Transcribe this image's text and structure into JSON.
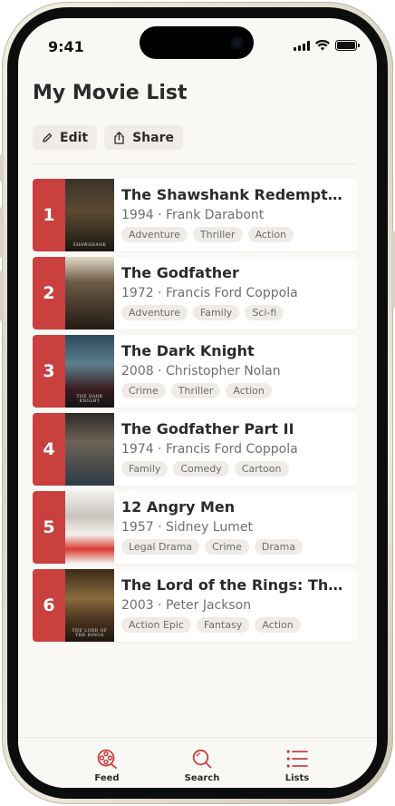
{
  "status_bar": {
    "time": "9:41"
  },
  "header": {
    "title": "My Movie List"
  },
  "actions": {
    "edit_label": "Edit",
    "share_label": "Share"
  },
  "movies": [
    {
      "rank": "1",
      "title": "The Shawshank Redemption",
      "meta": "1994 · Frank Darabont",
      "tags": [
        "Adventure",
        "Thriller",
        "Action"
      ],
      "poster_bg": "linear-gradient(180deg,#3b3329 0%,#5b4a33 45%,#1a1712 100%)",
      "poster_text": "SHAWSHANK"
    },
    {
      "rank": "2",
      "title": "The Godfather",
      "meta": "1972 · Francis Ford Coppola",
      "tags": [
        "Adventure",
        "Family",
        "Sci-fi"
      ],
      "poster_bg": "linear-gradient(180deg,#e2d9c9 0%,#6b5a46 35%,#231b14 100%)",
      "poster_text": ""
    },
    {
      "rank": "3",
      "title": "The Dark Knight",
      "meta": "2008 · Christopher Nolan",
      "tags": [
        "Crime",
        "Thriller",
        "Action"
      ],
      "poster_bg": "linear-gradient(180deg,#2c4b5e 0%,#5c7f8e 40%,#3a1c1f 75%,#121518 100%)",
      "poster_text": "THE DARK KNIGHT"
    },
    {
      "rank": "4",
      "title": "The Godfather Part II",
      "meta": "1974 · Francis Ford Coppola",
      "tags": [
        "Family",
        "Comedy",
        "Cartoon"
      ],
      "poster_bg": "linear-gradient(180deg,#2f2a26 0%,#6d6256 40%,#2e3b45 100%)",
      "poster_text": ""
    },
    {
      "rank": "5",
      "title": "12 Angry Men",
      "meta": "1957 · Sidney Lumet",
      "tags": [
        "Legal Drama",
        "Crime",
        "Drama"
      ],
      "poster_bg": "linear-gradient(180deg,#f2f0ec 0%,#c9c5bd 35%,#f4f2ee 60%,#d93a32 80%,#f4f2ee 100%)",
      "poster_text": ""
    },
    {
      "rank": "6",
      "title": "The Lord of the Rings: The Re...",
      "meta": "2003 · Peter Jackson",
      "tags": [
        "Action Epic",
        "Fantasy",
        "Action"
      ],
      "poster_bg": "linear-gradient(180deg,#3c2a1a 0%,#8a6a3c 40%,#4a3520 70%,#1f1610 100%)",
      "poster_text": "THE LORD OF THE RINGS"
    }
  ],
  "tabs": [
    {
      "label": "Feed",
      "icon": "film-reel-icon"
    },
    {
      "label": "Search",
      "icon": "search-icon"
    },
    {
      "label": "Lists",
      "icon": "list-icon"
    }
  ],
  "colors": {
    "accent": "#c9403f",
    "background": "#faf8f5",
    "tag_bg": "#efece7"
  }
}
